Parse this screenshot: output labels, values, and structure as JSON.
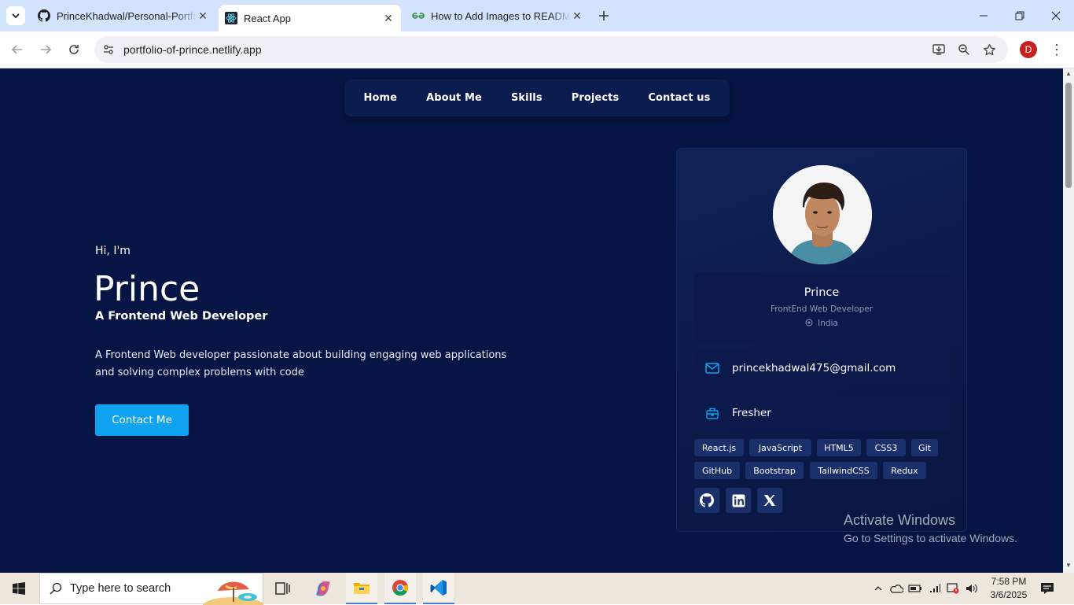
{
  "browser": {
    "tabs": [
      {
        "title": "PrinceKhadwal/Personal-Portfolio",
        "icon": "github-icon",
        "active": false
      },
      {
        "title": "React App",
        "icon": "react-icon",
        "active": true
      },
      {
        "title": "How to Add Images to README",
        "icon": "gfg-icon",
        "active": false
      }
    ],
    "url": "portfolio-of-prince.netlify.app",
    "profile_initial": "D"
  },
  "site": {
    "nav": [
      "Home",
      "About Me",
      "Skills",
      "Projects",
      "Contact us"
    ],
    "hero": {
      "greeting": "Hi, I'm",
      "name": "Prince",
      "role": "A Frontend Web Developer",
      "description": "A Frontend Web developer passionate about building engaging web applications and solving complex problems with code",
      "cta": "Contact Me"
    },
    "profile_card": {
      "name": "Prince",
      "title": "FrontEnd Web Developer",
      "location": "India",
      "email": "princekhadwal475@gmail.com",
      "experience": "Fresher",
      "skills": [
        "React.js",
        "JavaScript",
        "HTML5",
        "CSS3",
        "Git",
        "GitHub",
        "Bootstrap",
        "TailwindCSS",
        "Redux"
      ],
      "socials": [
        "github-icon",
        "linkedin-icon",
        "x-icon"
      ]
    }
  },
  "watermark": {
    "line1": "Activate Windows",
    "line2": "Go to Settings to activate Windows."
  },
  "taskbar": {
    "search_placeholder": "Type here to search",
    "time": "7:58 PM",
    "date": "3/6/2025"
  },
  "colors": {
    "page_bg": "#071544",
    "accent": "#0ea2f0",
    "chip_bg": "#1b2f6b",
    "tabstrip": "#d3e3fd"
  }
}
